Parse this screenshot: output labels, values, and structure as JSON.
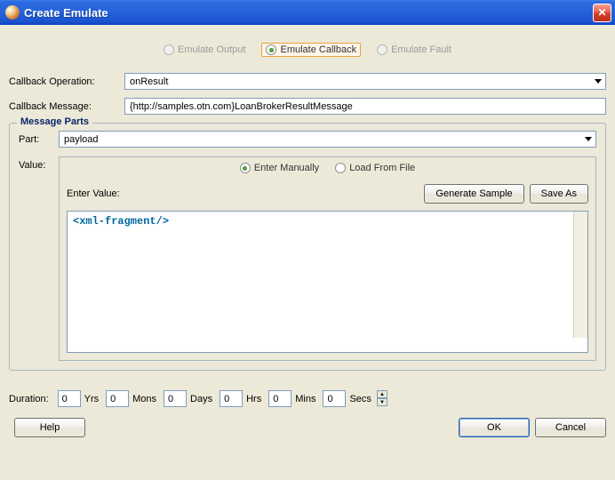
{
  "window": {
    "title": "Create Emulate"
  },
  "modes": {
    "output": "Emulate Output",
    "callback": "Emulate Callback",
    "fault": "Emulate Fault"
  },
  "labels": {
    "callback_operation": "Callback Operation:",
    "callback_message": "Callback Message:",
    "message_parts": "Message Parts",
    "part": "Part:",
    "value": "Value:",
    "enter_manually": "Enter Manually",
    "load_from_file": "Load From File",
    "enter_value": "Enter Value:",
    "generate_sample": "Generate Sample",
    "save_as": "Save As",
    "duration": "Duration:",
    "yrs": "Yrs",
    "mons": "Mons",
    "days": "Days",
    "hrs": "Hrs",
    "mins": "Mins",
    "secs": "Secs",
    "help": "Help",
    "ok": "OK",
    "cancel": "Cancel"
  },
  "values": {
    "callback_operation": "onResult",
    "callback_message": "{http://samples.otn.com}LoanBrokerResultMessage",
    "part": "payload",
    "xml": "<xml-fragment/>",
    "dur_yrs": "0",
    "dur_mons": "0",
    "dur_days": "0",
    "dur_hrs": "0",
    "dur_mins": "0",
    "dur_secs": "0"
  }
}
